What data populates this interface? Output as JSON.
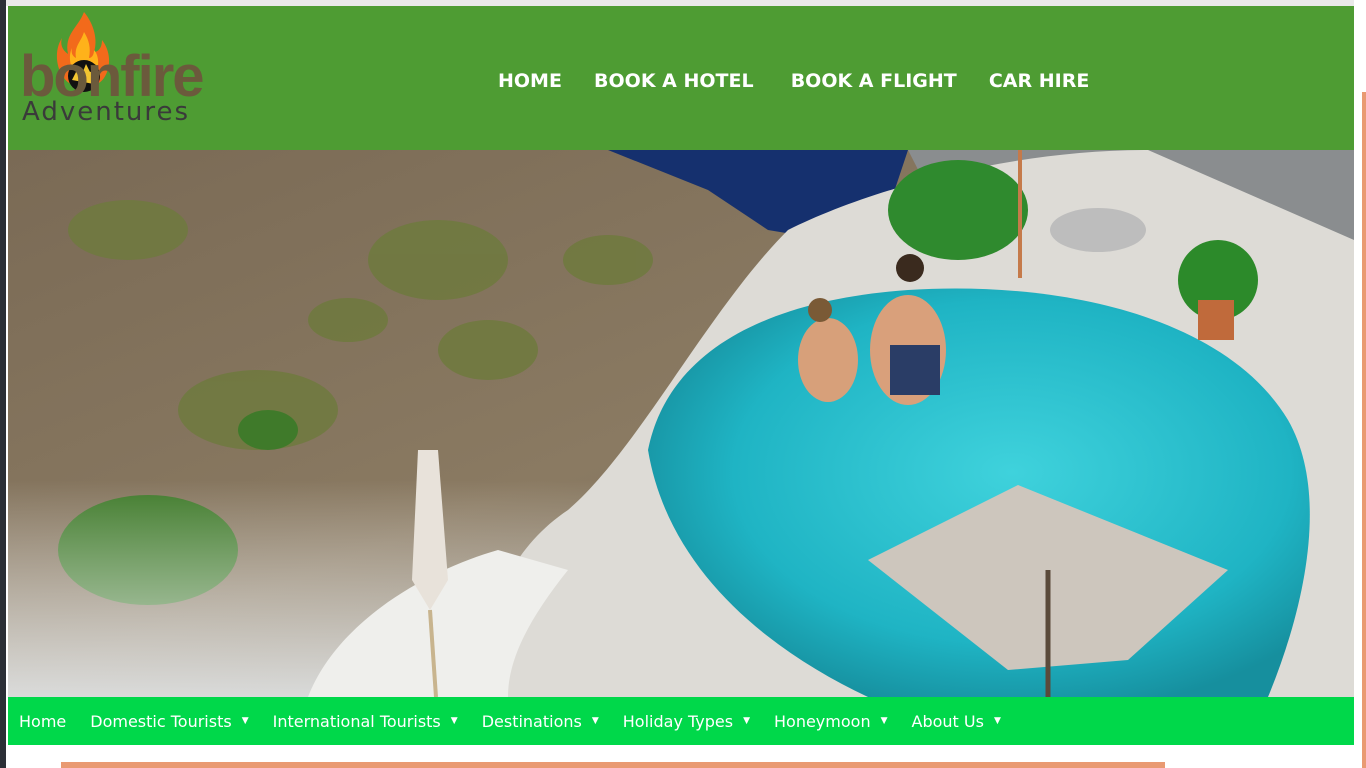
{
  "logo": {
    "word": "bonfire",
    "sub": "Adventures",
    "icon": "flame-logo-icon"
  },
  "top_nav": [
    {
      "label": "HOME"
    },
    {
      "label": "BOOK A HOTEL"
    },
    {
      "label": "BOOK A FLIGHT"
    },
    {
      "label": "CAR HIRE"
    }
  ],
  "hero": {
    "image": "couple-in-infinity-pool-overlooking-sea"
  },
  "menu": [
    {
      "label": "Home",
      "has_dropdown": false
    },
    {
      "label": "Domestic Tourists",
      "has_dropdown": true
    },
    {
      "label": "International Tourists",
      "has_dropdown": true
    },
    {
      "label": "Destinations",
      "has_dropdown": true
    },
    {
      "label": "Holiday Types",
      "has_dropdown": true
    },
    {
      "label": "Honeymoon",
      "has_dropdown": true
    },
    {
      "label": "About Us",
      "has_dropdown": true
    }
  ],
  "colors": {
    "header_green": "#4e9c33",
    "menu_green": "#00d84a",
    "accent_orange": "#e99a72"
  }
}
